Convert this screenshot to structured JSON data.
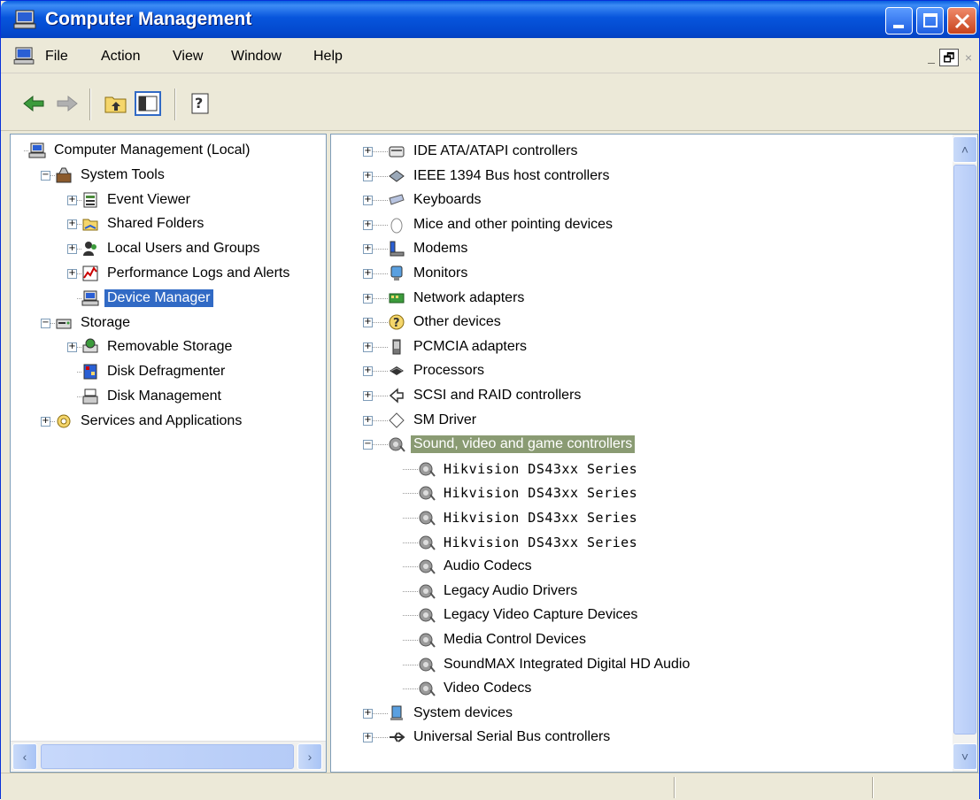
{
  "window": {
    "title": "Computer Management"
  },
  "menu": [
    "File",
    "Action",
    "View",
    "Window",
    "Help"
  ],
  "mdi_controls": [
    "_",
    "🗗",
    "×"
  ],
  "left_tree": [
    {
      "label": "Computer Management (Local)",
      "icon": "computer-icon",
      "level": 0,
      "expander": null
    },
    {
      "label": "System Tools",
      "icon": "tools-icon",
      "level": 1,
      "expander": "−"
    },
    {
      "label": "Event Viewer",
      "icon": "event-viewer-icon",
      "level": 2,
      "expander": "+"
    },
    {
      "label": "Shared Folders",
      "icon": "shared-folder-icon",
      "level": 2,
      "expander": "+"
    },
    {
      "label": "Local Users and Groups",
      "icon": "users-icon",
      "level": 2,
      "expander": "+"
    },
    {
      "label": "Performance Logs and Alerts",
      "icon": "performance-icon",
      "level": 2,
      "expander": "+"
    },
    {
      "label": "Device Manager",
      "icon": "device-manager-icon",
      "level": 2,
      "expander": null,
      "selected": true
    },
    {
      "label": "Storage",
      "icon": "storage-icon",
      "level": 1,
      "expander": "−"
    },
    {
      "label": "Removable Storage",
      "icon": "removable-storage-icon",
      "level": 2,
      "expander": "+"
    },
    {
      "label": "Disk Defragmenter",
      "icon": "defrag-icon",
      "level": 2,
      "expander": null
    },
    {
      "label": "Disk Management",
      "icon": "disk-management-icon",
      "level": 2,
      "expander": null
    },
    {
      "label": "Services and Applications",
      "icon": "services-icon",
      "level": 1,
      "expander": "+"
    }
  ],
  "right_tree": [
    {
      "label": "IDE ATA/ATAPI controllers",
      "icon": "ide-controller-icon",
      "level": 0,
      "expander": "+"
    },
    {
      "label": "IEEE 1394 Bus host controllers",
      "icon": "ieee1394-icon",
      "level": 0,
      "expander": "+"
    },
    {
      "label": "Keyboards",
      "icon": "keyboard-icon",
      "level": 0,
      "expander": "+"
    },
    {
      "label": "Mice and other pointing devices",
      "icon": "mouse-icon",
      "level": 0,
      "expander": "+"
    },
    {
      "label": "Modems",
      "icon": "modem-icon",
      "level": 0,
      "expander": "+"
    },
    {
      "label": "Monitors",
      "icon": "monitor-icon",
      "level": 0,
      "expander": "+"
    },
    {
      "label": "Network adapters",
      "icon": "network-adapter-icon",
      "level": 0,
      "expander": "+"
    },
    {
      "label": "Other devices",
      "icon": "unknown-device-icon",
      "level": 0,
      "expander": "+"
    },
    {
      "label": "PCMCIA adapters",
      "icon": "pcmcia-icon",
      "level": 0,
      "expander": "+"
    },
    {
      "label": "Processors",
      "icon": "processor-icon",
      "level": 0,
      "expander": "+"
    },
    {
      "label": "SCSI and RAID controllers",
      "icon": "scsi-icon",
      "level": 0,
      "expander": "+"
    },
    {
      "label": "SM Driver",
      "icon": "sm-driver-icon",
      "level": 0,
      "expander": "+"
    },
    {
      "label": "Sound, video and game controllers",
      "icon": "sound-icon",
      "level": 0,
      "expander": "−",
      "selected": true
    },
    {
      "label": "Hikvision DS43xx Series",
      "icon": "sound-icon",
      "level": 1,
      "expander": null,
      "mono": true
    },
    {
      "label": "Hikvision DS43xx Series",
      "icon": "sound-icon",
      "level": 1,
      "expander": null,
      "mono": true
    },
    {
      "label": "Hikvision DS43xx Series",
      "icon": "sound-icon",
      "level": 1,
      "expander": null,
      "mono": true
    },
    {
      "label": "Hikvision DS43xx Series",
      "icon": "sound-icon",
      "level": 1,
      "expander": null,
      "mono": true
    },
    {
      "label": "Audio Codecs",
      "icon": "sound-icon",
      "level": 1,
      "expander": null
    },
    {
      "label": "Legacy Audio Drivers",
      "icon": "sound-icon",
      "level": 1,
      "expander": null
    },
    {
      "label": "Legacy Video Capture Devices",
      "icon": "sound-icon",
      "level": 1,
      "expander": null
    },
    {
      "label": "Media Control Devices",
      "icon": "sound-icon",
      "level": 1,
      "expander": null
    },
    {
      "label": "SoundMAX Integrated Digital HD Audio",
      "icon": "sound-icon",
      "level": 1,
      "expander": null
    },
    {
      "label": "Video Codecs",
      "icon": "sound-icon",
      "level": 1,
      "expander": null
    },
    {
      "label": "System devices",
      "icon": "system-device-icon",
      "level": 0,
      "expander": "+"
    },
    {
      "label": "Universal Serial Bus controllers",
      "icon": "usb-icon",
      "level": 0,
      "expander": "+"
    }
  ],
  "colors": {
    "selection": "#316ac5",
    "inactive_selection": "#8a9b73",
    "titlebar": "#0755dc"
  }
}
